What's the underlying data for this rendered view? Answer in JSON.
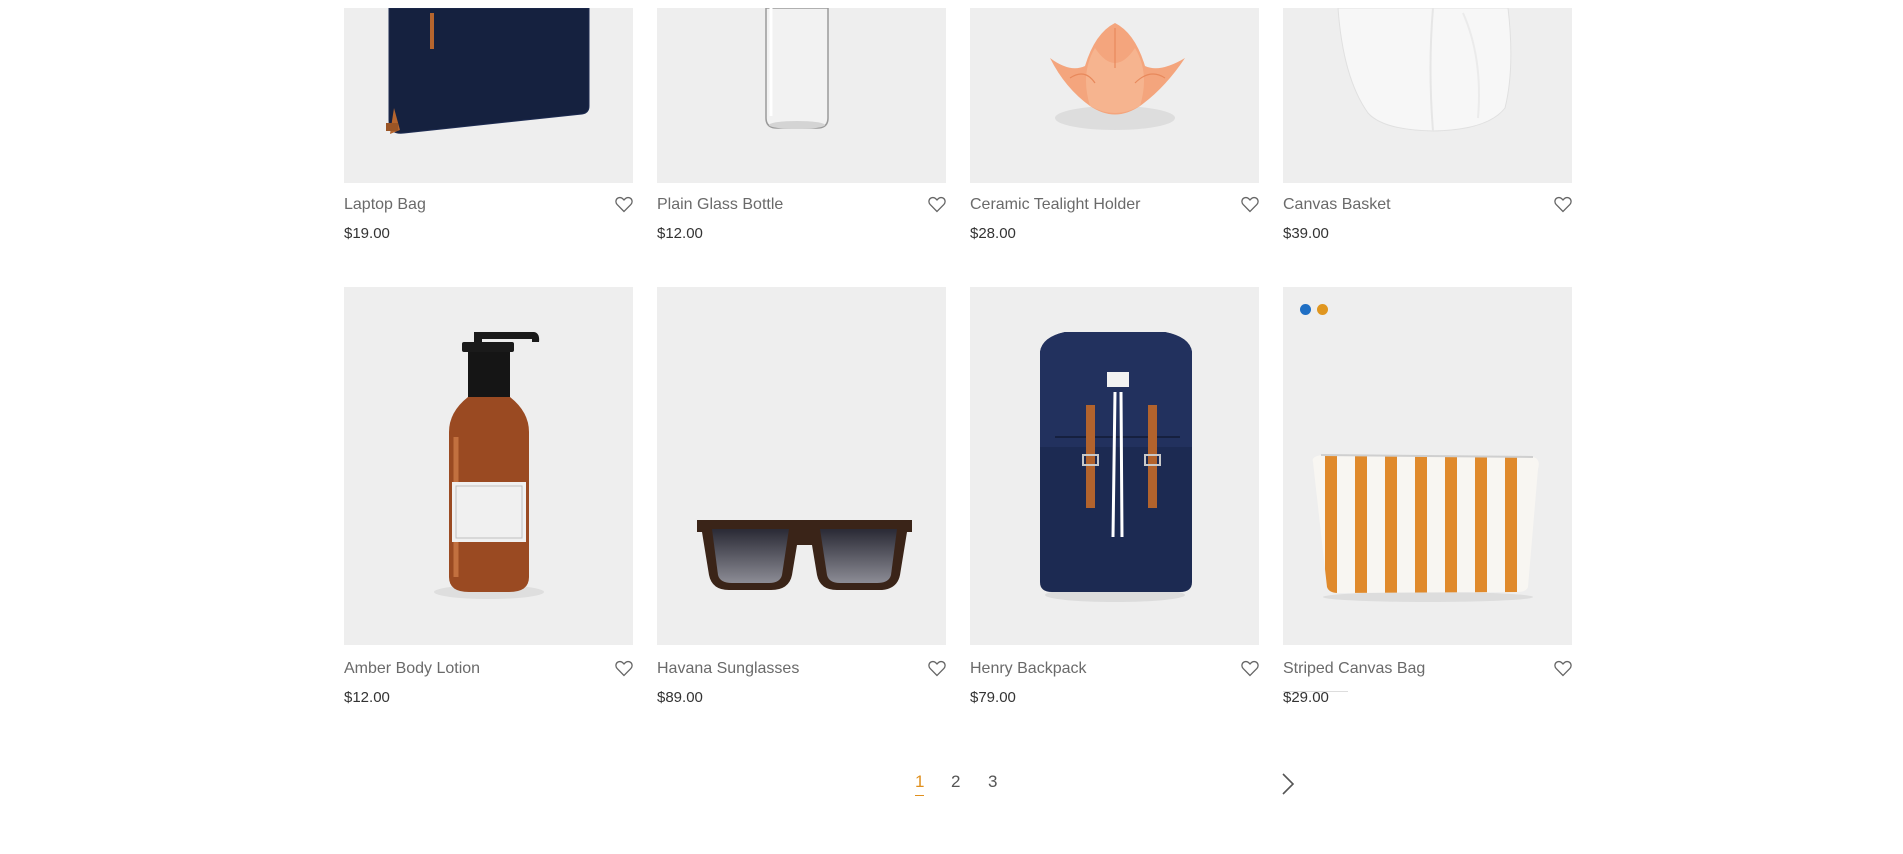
{
  "products": [
    {
      "name": "Laptop Bag",
      "price": "$19.00"
    },
    {
      "name": "Plain Glass Bottle",
      "price": "$12.00"
    },
    {
      "name": "Ceramic Tealight Holder",
      "price": "$28.00"
    },
    {
      "name": "Canvas Basket",
      "price": "$39.00"
    },
    {
      "name": "Amber Body Lotion",
      "price": "$12.00"
    },
    {
      "name": "Havana Sunglasses",
      "price": "$89.00"
    },
    {
      "name": "Henry Backpack",
      "price": "$79.00"
    },
    {
      "name": "Striped Canvas Bag",
      "price": "$29.00",
      "swatches": [
        "#1f6fc4",
        "#e0961f"
      ]
    }
  ],
  "icons": {
    "wishlist": "heart-icon",
    "next": "chevron-right-icon"
  },
  "pagination": {
    "pages": [
      "1",
      "2",
      "3"
    ],
    "current": "1"
  },
  "colors": {
    "accent": "#e0901e",
    "image_bg": "#eeeeee"
  }
}
